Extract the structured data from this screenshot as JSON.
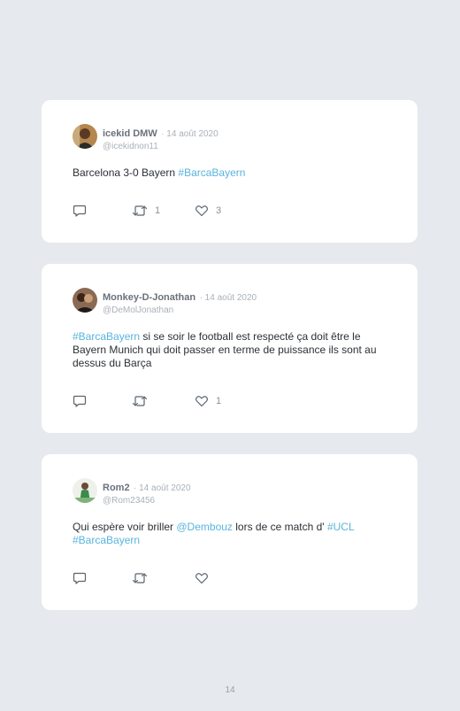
{
  "tweets": [
    {
      "name": "icekid DMW",
      "date": "· 14 août 2020",
      "handle": "@icekidnon11",
      "text_parts": [
        {
          "t": "Barcelona 3-0 Bayern "
        },
        {
          "t": "#BarcaBayern",
          "tag": true
        }
      ],
      "retweets": "1",
      "likes": "3"
    },
    {
      "name": "Monkey-D-Jonathan",
      "date": "· 14 août 2020",
      "handle": "@DeMolJonathan",
      "text_parts": [
        {
          "t": "#BarcaBayern",
          "tag": true
        },
        {
          "t": " si se soir le football est respecté ça doit être le Bayern Munich qui doit passer en terme de puissance ils sont au dessus du Barça"
        }
      ],
      "retweets": "",
      "likes": "1"
    },
    {
      "name": "Rom2",
      "date": "· 14 août 2020",
      "handle": "@Rom23456",
      "text_parts": [
        {
          "t": "Qui espère voir briller "
        },
        {
          "t": "@Dembouz",
          "tag": true
        },
        {
          "t": " lors de ce match d' "
        },
        {
          "t": "#UCL",
          "tag": true
        },
        {
          "t": " "
        },
        {
          "t": "#BarcaBayern",
          "tag": true
        }
      ],
      "retweets": "",
      "likes": ""
    }
  ],
  "page_number": "14",
  "icons": {
    "reply": "reply-icon",
    "retweet": "retweet-icon",
    "like": "heart-icon"
  },
  "colors": {
    "background": "#e6e9ed",
    "card": "#ffffff",
    "link": "#59b4dd",
    "name": "#69727c",
    "muted": "#aab1b8"
  }
}
